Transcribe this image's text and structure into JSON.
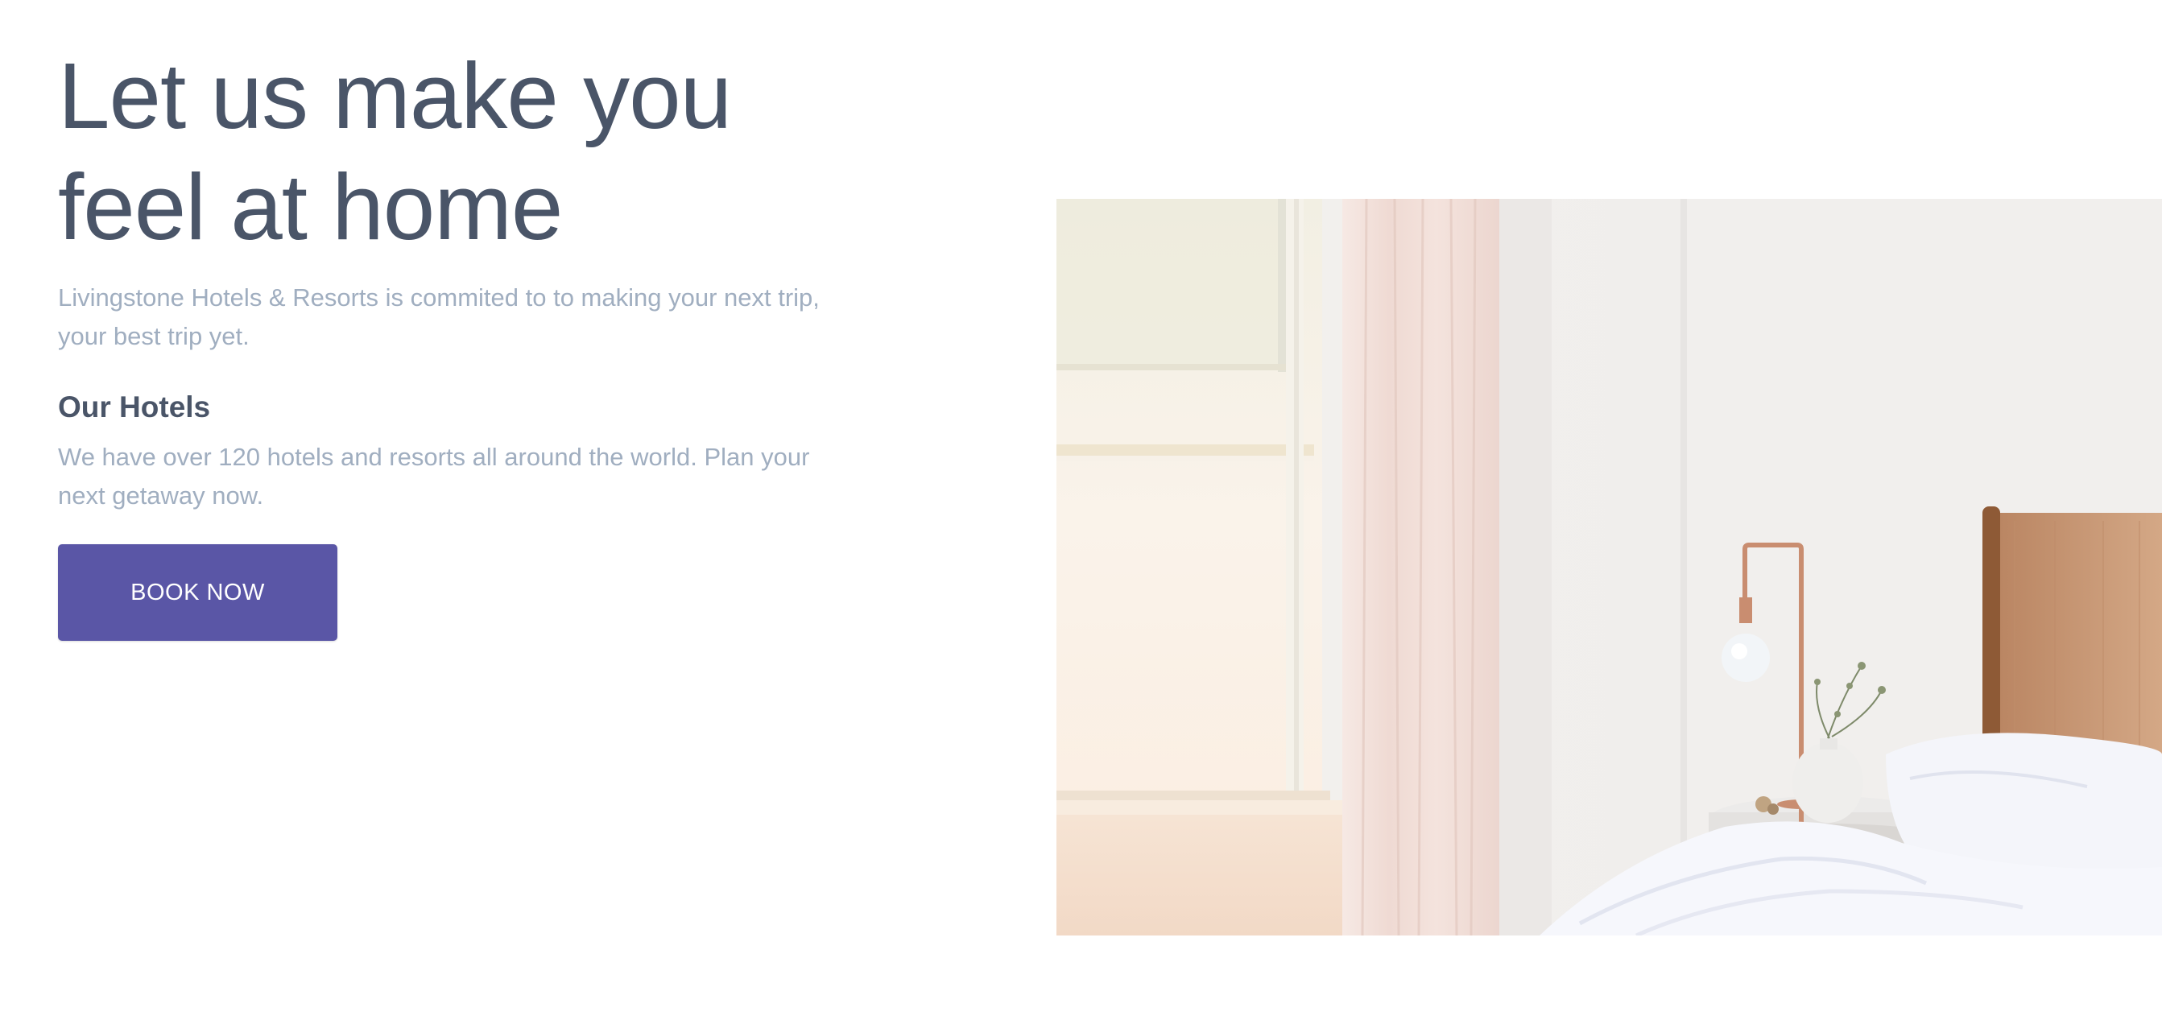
{
  "hero": {
    "headline": "Let us make you feel at home",
    "tagline": "Livingstone Hotels & Resorts is commited to to making your next trip, your best trip yet.",
    "section_title": "Our Hotels",
    "section_text": "We have over 120 hotels and resorts all around the world. Plan your next getaway now.",
    "cta_label": "BOOK NOW"
  },
  "image": {
    "subject": "bedroom-photo"
  },
  "colors": {
    "heading": "#4a5568",
    "muted": "#a0aec0",
    "accent": "#5a56a6",
    "background": "#ffffff"
  }
}
